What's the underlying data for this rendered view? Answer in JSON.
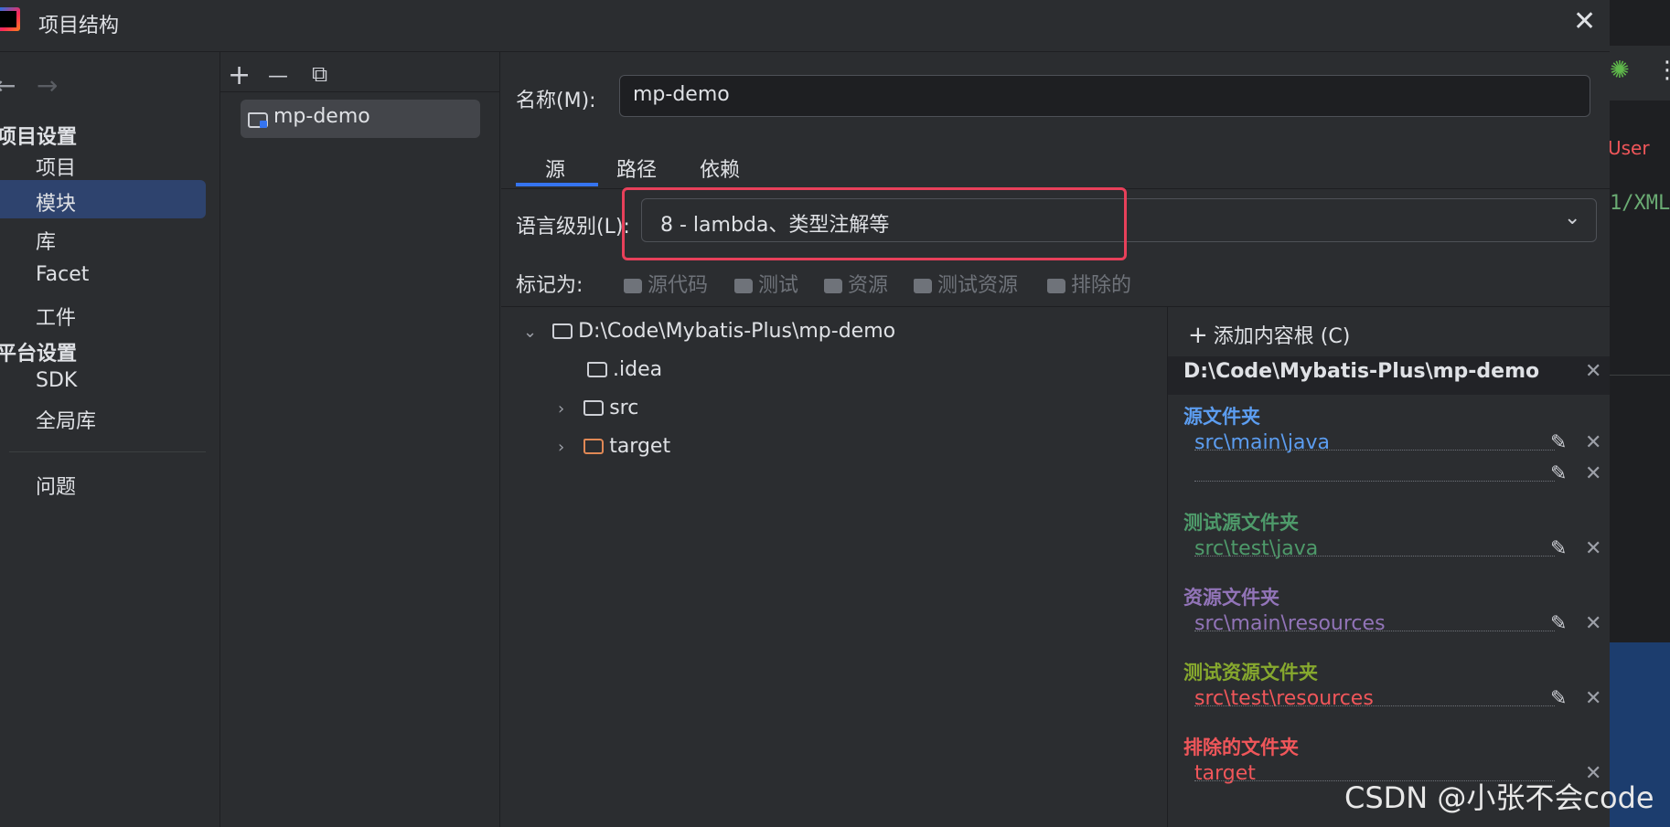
{
  "window": {
    "title": "项目结构"
  },
  "editor_fragments": {
    "user": "User",
    "xml": "1/XML"
  },
  "nav": {
    "back": "←",
    "forward": "→",
    "project_settings": "项目设置",
    "project_items": [
      "项目",
      "模块",
      "库",
      "Facet",
      "工件"
    ],
    "platform_settings": "平台设置",
    "platform_items": [
      "SDK",
      "全局库"
    ],
    "problems": "问题",
    "selected": "模块"
  },
  "modules": {
    "add": "+",
    "remove": "—",
    "copy": "⧉",
    "items": [
      "mp-demo"
    ]
  },
  "main": {
    "name_label": "名称(M):",
    "name_value": "mp-demo",
    "tabs": [
      "源",
      "路径",
      "依赖"
    ],
    "active_tab": "源",
    "lang_label": "语言级别(L):",
    "lang_value": "8 - lambda、类型注解等",
    "mark_label": "标记为:",
    "mark_buttons": [
      "源代码",
      "测试",
      "资源",
      "测试资源",
      "排除的"
    ]
  },
  "tree": {
    "root": "D:\\Code\\Mybatis-Plus\\mp-demo",
    "children": [
      ".idea",
      "src",
      "target"
    ]
  },
  "roots": {
    "add_label": "添加内容根 (C)",
    "path": "D:\\Code\\Mybatis-Plus\\mp-demo",
    "sections": [
      {
        "title": "源文件夹",
        "color": "#5c9df0",
        "entries": [
          "src\\main\\java",
          ""
        ]
      },
      {
        "title": "测试源文件夹",
        "color": "#4e9a6a",
        "entries": [
          "src\\test\\java"
        ]
      },
      {
        "title": "资源文件夹",
        "color": "#9274b8",
        "entries": [
          "src\\main\\resources"
        ]
      },
      {
        "title": "测试资源文件夹",
        "color": "#86a82e",
        "entries": [
          "src\\test\\resources"
        ]
      },
      {
        "title": "排除的文件夹",
        "color": "#f0565a",
        "entries": [
          "target"
        ]
      }
    ]
  },
  "watermark": "CSDN @小张不会code"
}
